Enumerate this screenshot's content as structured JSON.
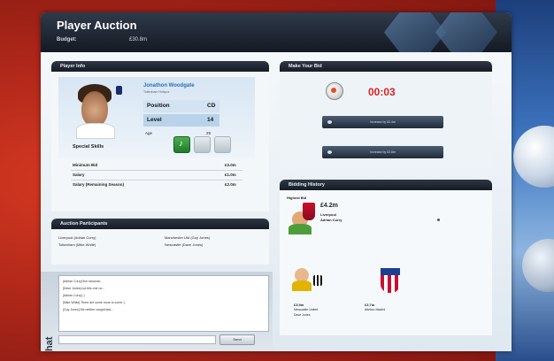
{
  "window": {
    "title": "Player Auction",
    "budget_label": "Budget:",
    "budget_value": "£30.8m"
  },
  "player_info": {
    "header": "Player Info",
    "name": "Jonathon Woodgate",
    "club": "Tottenham Hotspur",
    "position_label": "Position",
    "position_value": "CD",
    "level_label": "Level",
    "level_value": "14",
    "age_label": "Age",
    "age_value": "29",
    "special_skills_label": "Special Skills",
    "minimum_bid_label": "Minimum Bid",
    "minimum_bid_value": "£3.0m",
    "salary_label": "Salary",
    "salary_value": "£1.0m",
    "salary_remaining_label": "Salary (Remaining Season)",
    "salary_remaining_value": "£2.0m"
  },
  "participants": {
    "header": "Auction Participants",
    "left": [
      "Liverpool (Adrian Curry)",
      "Tottenham (Mike White)"
    ],
    "right": [
      "Manchester Utd (Guy Jones)",
      "Newcastle (Dave Jones)"
    ]
  },
  "bid": {
    "header": "Make Your Bid",
    "timer": "00:03",
    "button1": "Increase by £0.4m",
    "button2": "Increase by £0.8m"
  },
  "history": {
    "header": "Bidding History",
    "highest_label": "Highest Bid",
    "highest_amount": "£4.2m",
    "highest_club": "Liverpool",
    "highest_manager": "Adrian Curry",
    "bidder2_amount": "£3.9m",
    "bidder2_club": "Newcastle United",
    "bidder2_manager": "Dave Jones",
    "bidder3_amount": "£3.7m",
    "bidder3_club": "Atletico Madrid"
  },
  "chat": {
    "label": "Chat",
    "messages": [
      "[Adrian Curry] five seconds...",
      "[Dave Jones] not this one no...",
      "[Adrian Curry] :)",
      "[Mike White] There are some more to come :)",
      "[Guy Jones] Me neither caught last..."
    ],
    "send_label": "Send"
  },
  "colors": {
    "accent_red": "#d62424",
    "header_dark": "#1c232d",
    "blue_text": "#2a6fb8"
  }
}
